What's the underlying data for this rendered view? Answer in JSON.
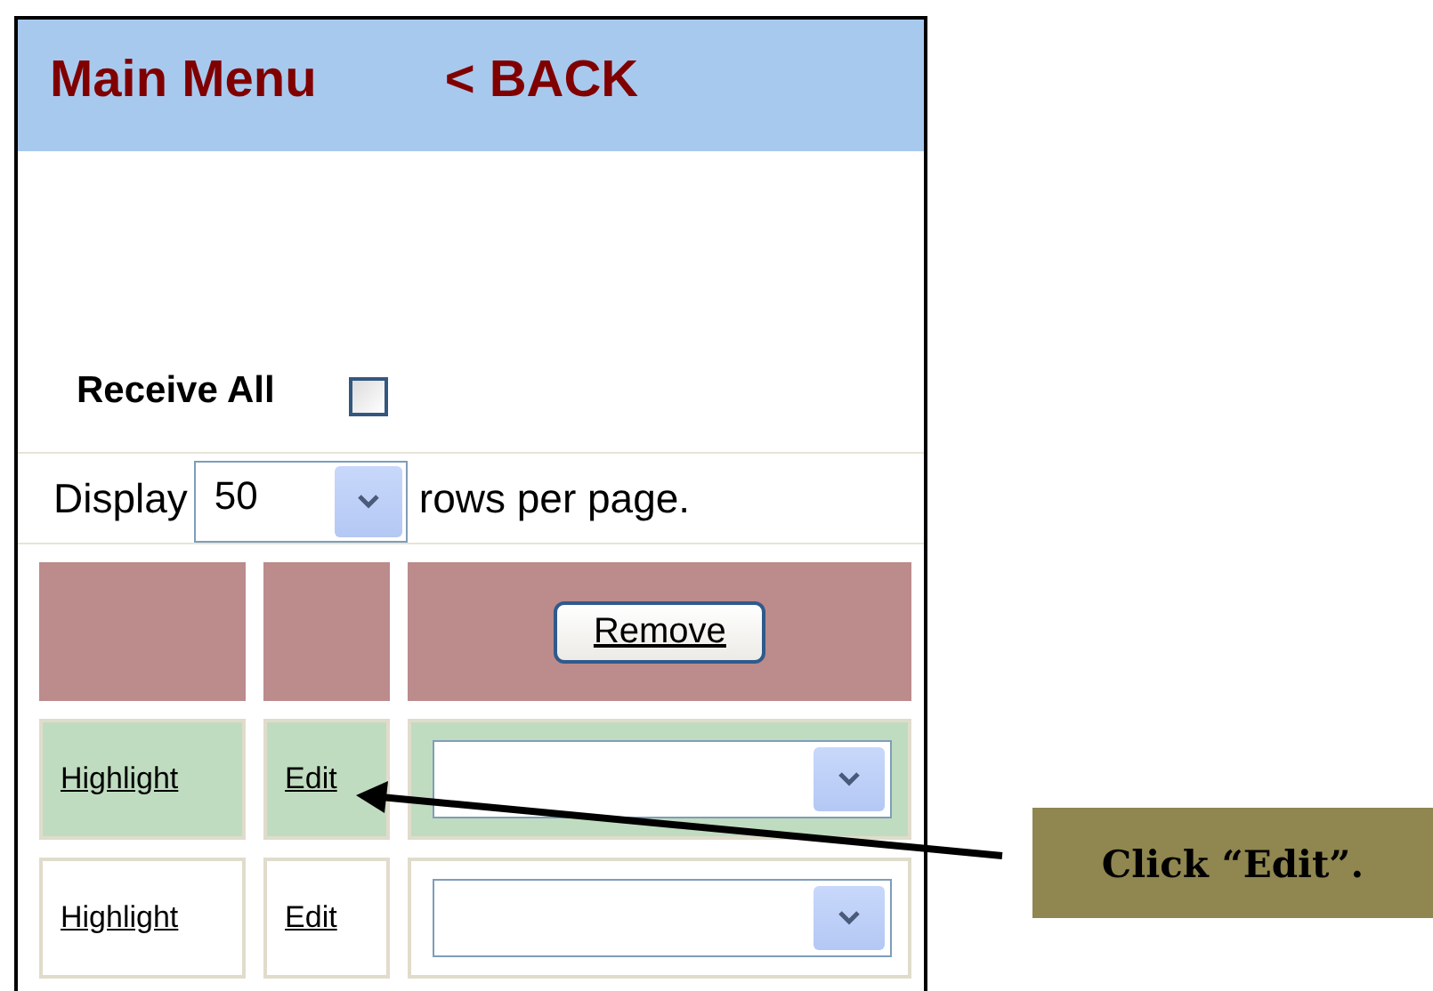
{
  "header": {
    "links": [
      "Main Menu",
      "< BACK"
    ]
  },
  "receive_all": {
    "label": "Receive All",
    "checked": false
  },
  "paging": {
    "prefix": "Display",
    "value": "50",
    "suffix": "rows per page."
  },
  "table": {
    "header_button": "Remove",
    "rows": [
      {
        "highlight_link": "Highlight",
        "edit_link": "Edit",
        "highlighted": true
      },
      {
        "highlight_link": "Highlight",
        "edit_link": "Edit",
        "highlighted": false
      }
    ]
  },
  "callout": {
    "text": "Click “Edit”."
  }
}
